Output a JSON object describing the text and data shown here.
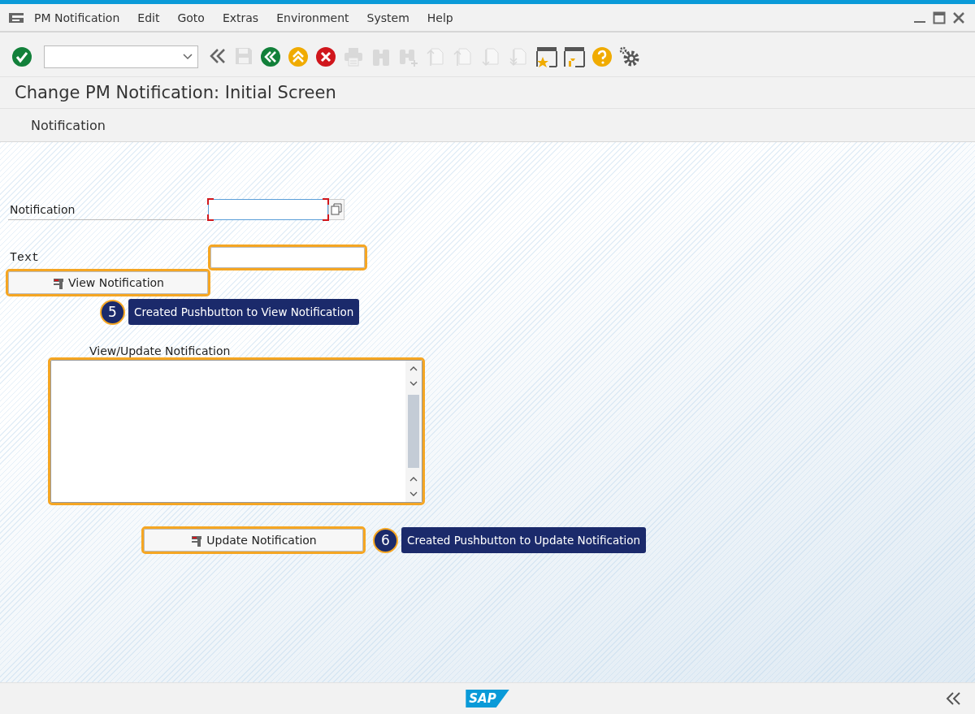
{
  "menu_bar": {
    "items": [
      {
        "label": "PM Notification"
      },
      {
        "label": "Edit"
      },
      {
        "label": "Goto"
      },
      {
        "label": "Extras"
      },
      {
        "label": "Environment"
      },
      {
        "label": "System"
      },
      {
        "label": "Help"
      }
    ]
  },
  "toolbar": [
    {
      "kind": "enter",
      "disabled": false
    },
    {
      "kind": "command_field"
    },
    {
      "kind": "collapse",
      "disabled": false
    },
    {
      "kind": "save",
      "disabled": true
    },
    {
      "kind": "back",
      "disabled": false
    },
    {
      "kind": "exit",
      "disabled": false
    },
    {
      "kind": "cancel",
      "disabled": false
    },
    {
      "kind": "print",
      "disabled": true
    },
    {
      "kind": "find",
      "disabled": true
    },
    {
      "kind": "find_next",
      "disabled": true
    },
    {
      "kind": "first_page",
      "disabled": true
    },
    {
      "kind": "previous_page",
      "disabled": true
    },
    {
      "kind": "next_page",
      "disabled": true
    },
    {
      "kind": "last_page",
      "disabled": true
    },
    {
      "kind": "new_session",
      "disabled": false
    },
    {
      "kind": "shortcut",
      "disabled": false
    },
    {
      "kind": "help",
      "disabled": false
    },
    {
      "kind": "settings",
      "disabled": false
    }
  ],
  "title": "Change PM Notification: Initial Screen",
  "application_toolbar": {
    "label": "Notification"
  },
  "form": {
    "notification": {
      "label": "Notification",
      "required": true,
      "highlighted": false
    },
    "text": {
      "label": "Text",
      "highlighted": true
    },
    "view_button": {
      "label": "View Notification",
      "highlighted": true
    },
    "view_callout": {
      "number": "5",
      "text": "Created Pushbutton to View Notification"
    },
    "editor": {
      "label": "View/Update Notification",
      "highlighted": true
    },
    "update_button": {
      "label": "Update Notification",
      "highlighted": true
    },
    "update_callout": {
      "number": "6",
      "text": "Created Pushbutton to Update Notification"
    }
  },
  "footer": {
    "logo": "SAP"
  }
}
